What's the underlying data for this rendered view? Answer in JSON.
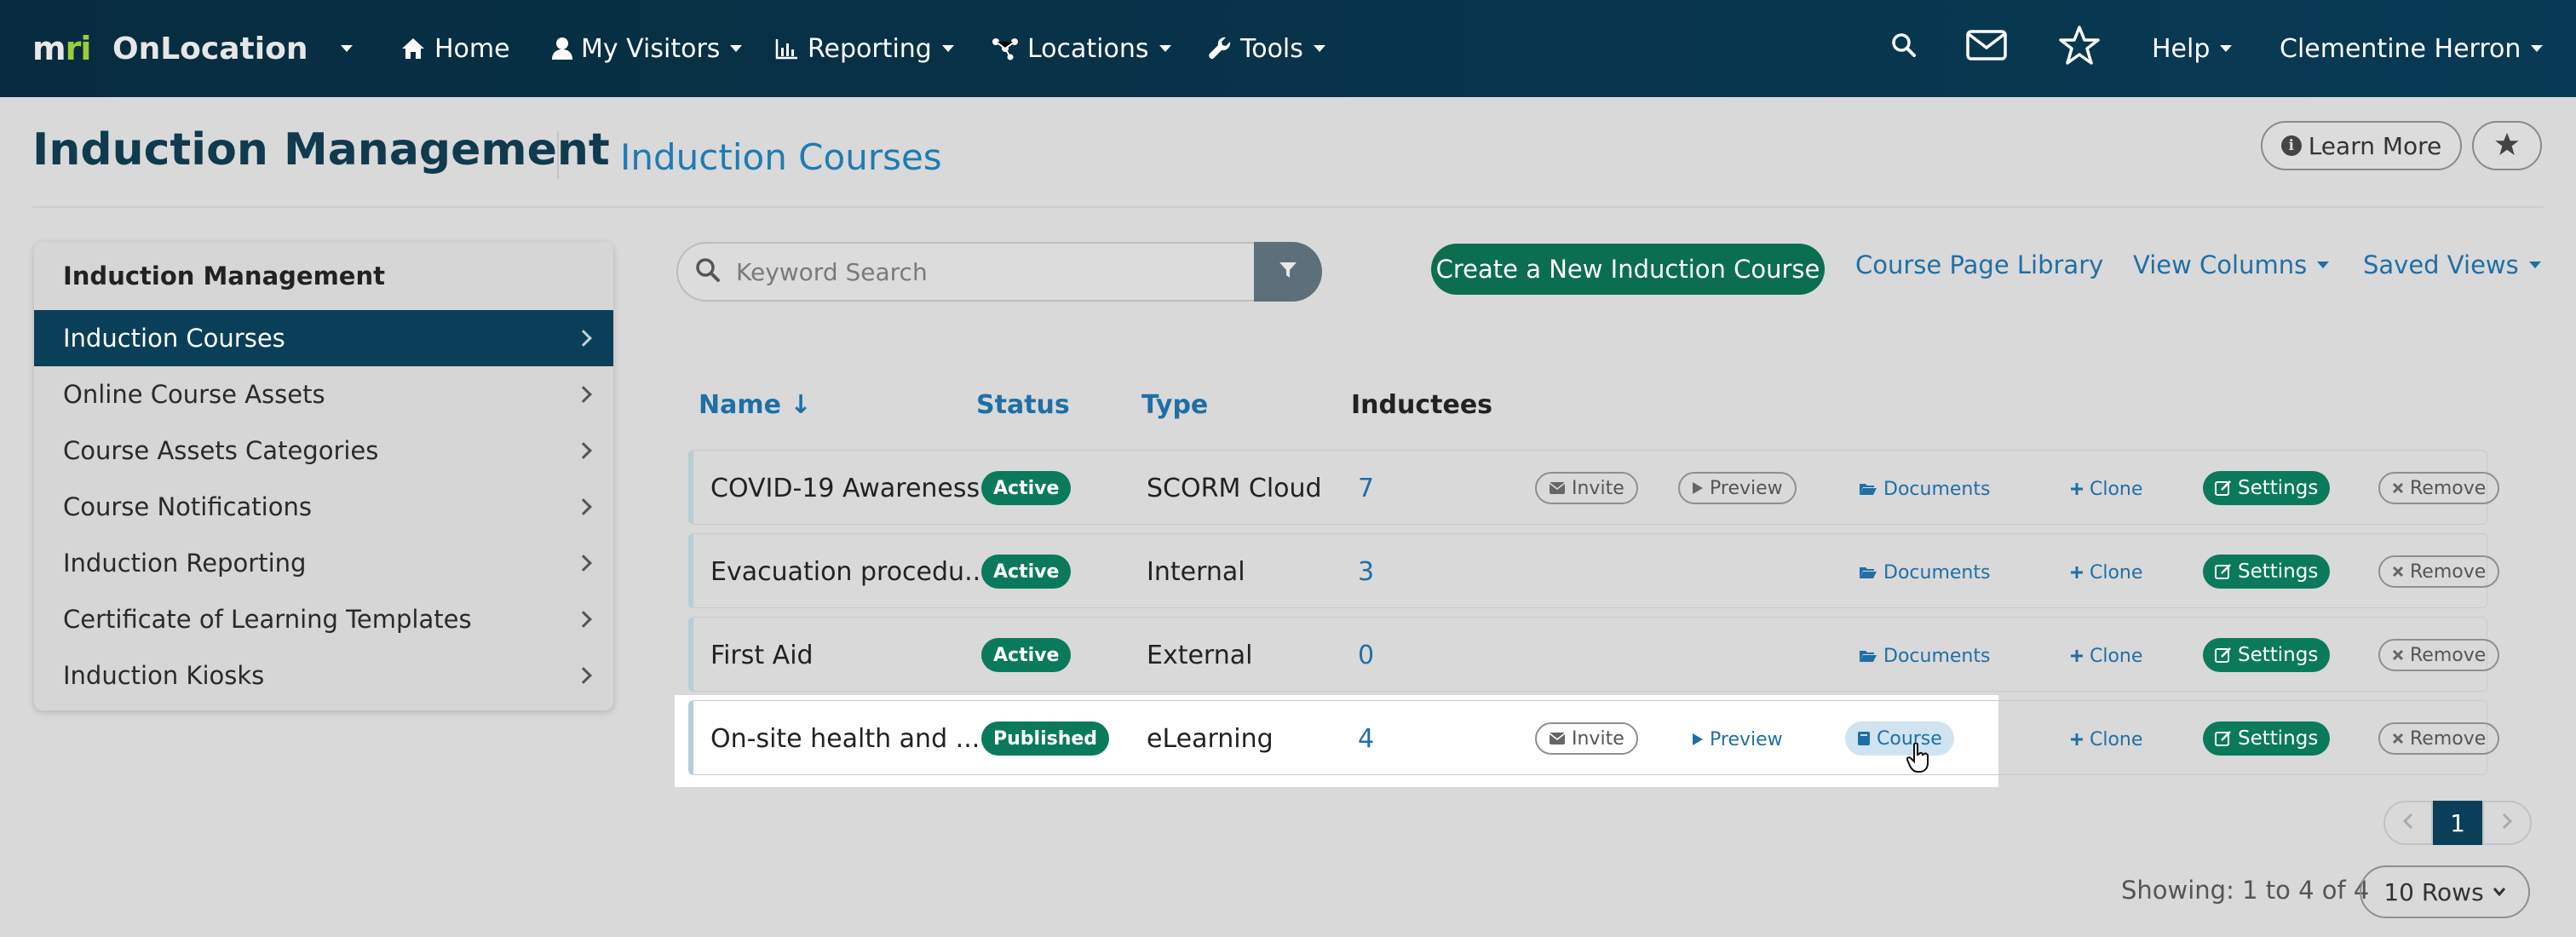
{
  "navbar": {
    "logo_m": "m",
    "logo_ri": "ri",
    "brand": "OnLocation",
    "home": "Home",
    "my_visitors": "My Visitors",
    "reporting": "Reporting",
    "locations": "Locations",
    "tools": "Tools",
    "help": "Help",
    "user": "Clementine Herron"
  },
  "header": {
    "title": "Induction Management",
    "subtitle": "Induction Courses",
    "learn_more": "Learn More"
  },
  "sidebar": {
    "heading": "Induction Management",
    "items": [
      {
        "label": "Induction Courses",
        "active": true
      },
      {
        "label": "Online Course Assets"
      },
      {
        "label": "Course Assets Categories"
      },
      {
        "label": "Course Notifications"
      },
      {
        "label": "Induction Reporting"
      },
      {
        "label": "Certificate of Learning Templates"
      },
      {
        "label": "Induction Kiosks"
      }
    ]
  },
  "toolbar": {
    "search_placeholder": "Keyword Search",
    "create_label": "Create a New Induction Course",
    "library_label": "Course Page Library",
    "view_columns_label": "View Columns",
    "saved_views_label": "Saved Views"
  },
  "table": {
    "headers": {
      "name": "Name ↓",
      "status": "Status",
      "type": "Type",
      "inductees": "Inductees"
    },
    "actions": {
      "invite": "Invite",
      "preview": "Preview",
      "documents": "Documents",
      "clone": "Clone",
      "settings": "Settings",
      "remove": "Remove",
      "course": "Course"
    },
    "rows": [
      {
        "name": "COVID-19 Awareness",
        "status": "Active",
        "type": "SCORM Cloud",
        "inductees": "7"
      },
      {
        "name": "Evacuation procedu...",
        "status": "Active",
        "type": "Internal",
        "inductees": "3"
      },
      {
        "name": "First Aid",
        "status": "Active",
        "type": "External",
        "inductees": "0"
      },
      {
        "name": "On-site health and ...",
        "status": "Published",
        "type": "eLearning",
        "inductees": "4"
      }
    ]
  },
  "pagination": {
    "current_page": "1",
    "showing": "Showing: 1 to 4 of 4",
    "rows_label": "10 Rows"
  },
  "colors": {
    "navbar": "#083a55",
    "accent_link": "#1f6fa6",
    "green": "#0b7a5c",
    "active_nav": "#0a3f5a"
  }
}
